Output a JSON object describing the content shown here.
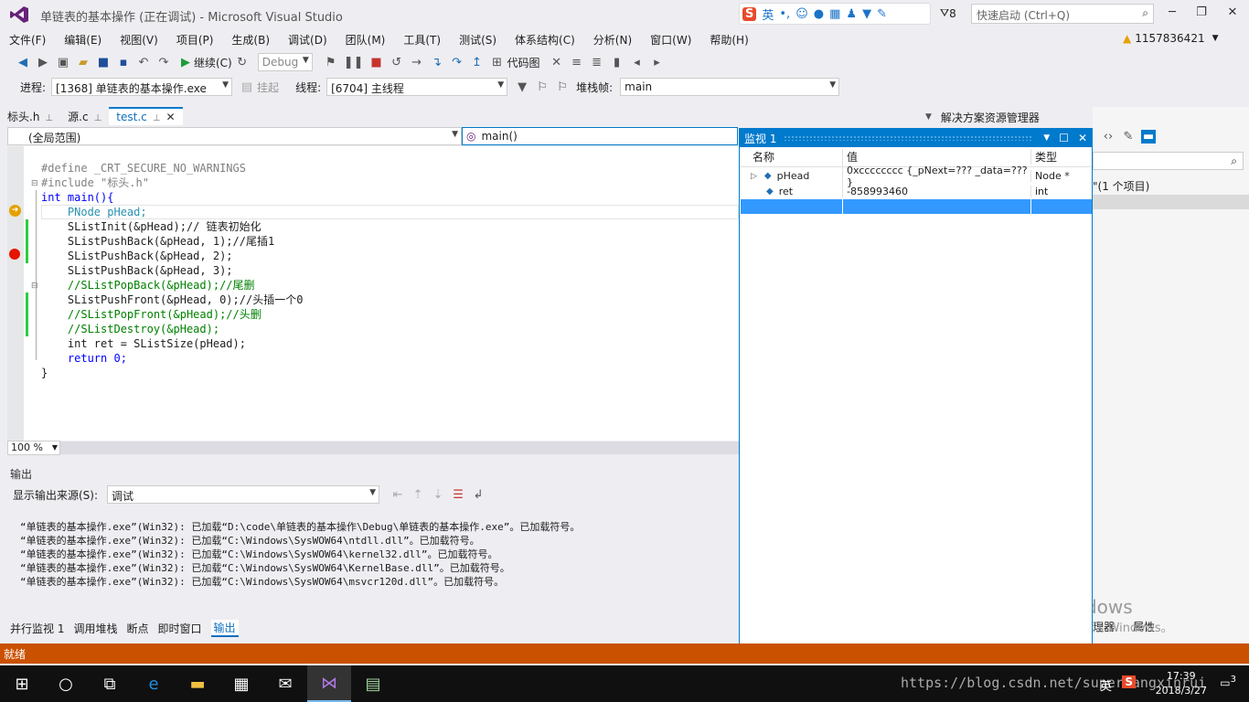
{
  "window": {
    "title": "单链表的基本操作 (正在调试) - Microsoft Visual Studio",
    "notification_count": "8",
    "quick_launch_placeholder": "快速启动 (Ctrl+Q)",
    "user": "1157836421"
  },
  "ime": {
    "brand": "S",
    "lang": "英"
  },
  "menu": [
    "文件(F)",
    "编辑(E)",
    "视图(V)",
    "项目(P)",
    "生成(B)",
    "调试(D)",
    "团队(M)",
    "工具(T)",
    "测试(S)",
    "体系结构(C)",
    "分析(N)",
    "窗口(W)",
    "帮助(H)"
  ],
  "toolbar": {
    "continue_label": "继续(C)",
    "config_value": "Debug",
    "codemap_label": "代码图"
  },
  "debugbar": {
    "process_label": "进程:",
    "process_value": "[1368] 单链表的基本操作.exe",
    "suspend_label": "挂起",
    "thread_label": "线程:",
    "thread_value": "[6704] 主线程",
    "stack_label": "堆栈帧:",
    "stack_value": "main"
  },
  "tabs": [
    {
      "label": "标头.h"
    },
    {
      "label": "源.c"
    },
    {
      "label": "test.c"
    }
  ],
  "navbar": {
    "scope": "(全局范围)",
    "function": "main()"
  },
  "editor": {
    "zoom": "100 %",
    "lines": [
      "#define _CRT_SECURE_NO_WARNINGS",
      "#include \"标头.h\"",
      "int main(){",
      "    PNode pHead;",
      "    SListInit(&pHead);// 链表初始化",
      "    SListPushBack(&pHead, 1);//尾插1",
      "    SListPushBack(&pHead, 2);",
      "    SListPushBack(&pHead, 3);",
      "    //SListPopBack(&pHead);//尾删",
      "    SListPushFront(&pHead, 0);//头插一个0",
      "    //SListPopFront(&pHead);//头删",
      "    //SListDestroy(&pHead);",
      "    int ret = SListSize(pHead);",
      "    return 0;",
      "}"
    ]
  },
  "output": {
    "title": "输出",
    "source_label": "显示输出来源(S):",
    "source_value": "调试",
    "lines": [
      "“单链表的基本操作.exe”(Win32): 已加载“D:\\code\\单链表的基本操作\\Debug\\单链表的基本操作.exe”。已加载符号。",
      "“单链表的基本操作.exe”(Win32): 已加载“C:\\Windows\\SysWOW64\\ntdll.dll”。已加载符号。",
      "“单链表的基本操作.exe”(Win32): 已加载“C:\\Windows\\SysWOW64\\kernel32.dll”。已加载符号。",
      "“单链表的基本操作.exe”(Win32): 已加载“C:\\Windows\\SysWOW64\\KernelBase.dll”。已加载符号。",
      "“单链表的基本操作.exe”(Win32): 已加载“C:\\Windows\\SysWOW64\\msvcr120d.dll”。已加载符号。"
    ]
  },
  "bottom_tabs": [
    "并行监视 1",
    "调用堆栈",
    "断点",
    "即时窗口",
    "输出"
  ],
  "status": "就绪",
  "watch": {
    "title": "监视 1",
    "headers": {
      "name": "名称",
      "value": "值",
      "type": "类型"
    },
    "rows": [
      {
        "name": "pHead",
        "value": "0xcccccccc {_pNext=??? _data=??? }",
        "type": "Node *"
      },
      {
        "name": "ret",
        "value": "-858993460",
        "type": "int"
      }
    ]
  },
  "solution_explorer": {
    "title": "解决方案资源管理器",
    "item_text": "\"(1 个项目)",
    "bottom_tabs": [
      "理器",
      "属性"
    ]
  },
  "activate_windows": {
    "line1": "激活 Windows",
    "line2": "转到“设置”以激活 Windows。"
  },
  "taskbar": {
    "time": "17:39",
    "date": "2018/3/27",
    "ime": "英",
    "notify_count": "3",
    "watermark": "https://blog.csdn.net/superwangxinrui"
  },
  "colors": {
    "accent": "#007acc",
    "status_debug": "#ca5100",
    "breakpoint": "#e51400"
  }
}
